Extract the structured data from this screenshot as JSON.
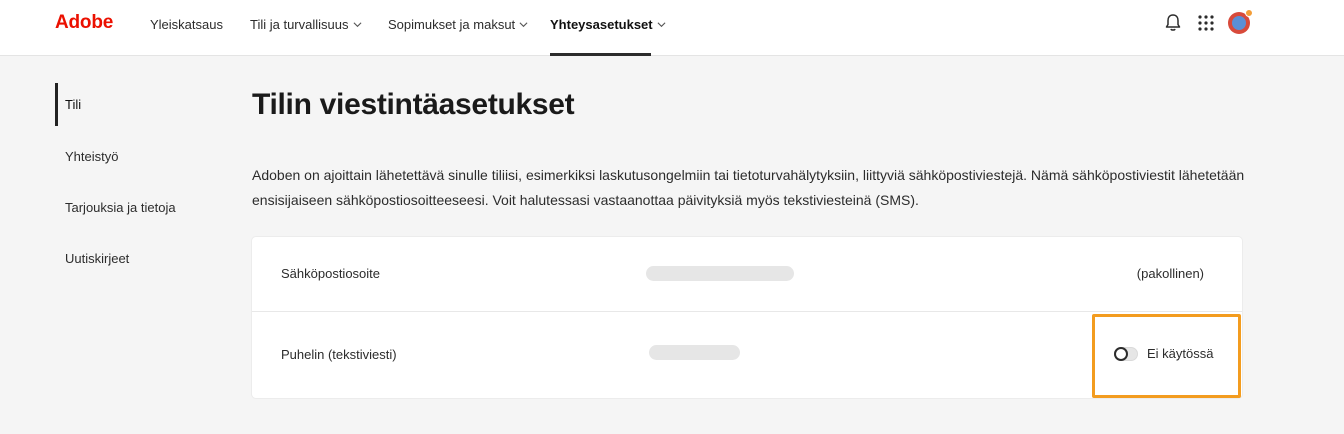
{
  "header": {
    "logo": "Adobe",
    "nav": [
      {
        "label": "Yleiskatsaus",
        "has_dropdown": false,
        "active": false
      },
      {
        "label": "Tili ja turvallisuus",
        "has_dropdown": true,
        "active": false
      },
      {
        "label": "Sopimukset ja maksut",
        "has_dropdown": true,
        "active": false
      },
      {
        "label": "Yhteysasetukset",
        "has_dropdown": true,
        "active": true
      }
    ],
    "icons": [
      "bell-icon",
      "app-grid-icon",
      "avatar"
    ]
  },
  "sidebar": {
    "items": [
      {
        "label": "Tili",
        "active": true
      },
      {
        "label": "Yhteistyö",
        "active": false
      },
      {
        "label": "Tarjouksia ja tietoja",
        "active": false
      },
      {
        "label": "Uutiskirjeet",
        "active": false
      }
    ]
  },
  "main": {
    "title": "Tilin viestintäasetukset",
    "description": "Adoben on ajoittain lähetettävä sinulle tiliisi, esimerkiksi laskutusongelmiin tai tietoturvahälytyksiin, liittyviä sähköpostiviestejä. Nämä sähköpostiviestit lähetetään ensisijaiseen sähköpostiosoitteeseesi. Voit halutessasi vastaanottaa päivityksiä myös tekstiviesteinä (SMS).",
    "rows": [
      {
        "label": "Sähköpostiosoite",
        "status": "(pakollinen)"
      },
      {
        "label": "Puhelin (tekstiviesti)",
        "toggle_label": "Ei käytössä",
        "toggle_on": false
      }
    ]
  },
  "colors": {
    "brand": "#eb1000",
    "highlight": "#f39c1f"
  }
}
